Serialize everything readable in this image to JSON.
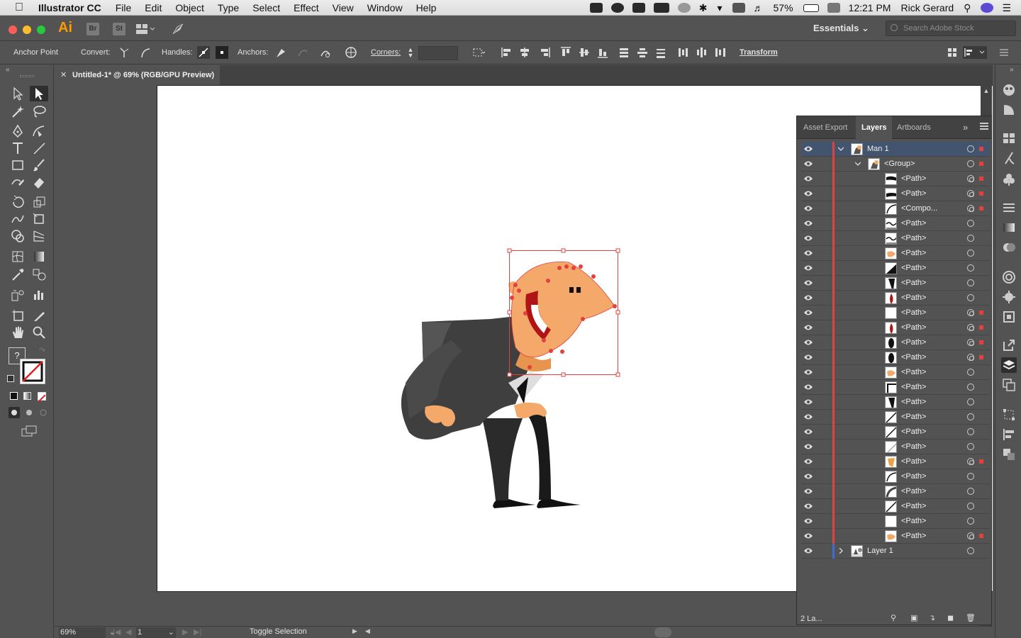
{
  "menubar": {
    "app_name": "Illustrator CC",
    "menus": [
      "File",
      "Edit",
      "Object",
      "Type",
      "Select",
      "Effect",
      "View",
      "Window",
      "Help"
    ],
    "battery": "57%",
    "time": "12:21 PM",
    "user": "Rick Gerard"
  },
  "appbar": {
    "logo": "Ai",
    "bridge": "Br",
    "stock": "St",
    "workspace": "Essentials",
    "search_placeholder": "Search Adobe Stock"
  },
  "control": {
    "tool_name": "Anchor Point",
    "convert": "Convert:",
    "handles": "Handles:",
    "anchors": "Anchors:",
    "corners": "Corners:",
    "transform": "Transform"
  },
  "document": {
    "tab_title": "Untitled-1* @ 69% (RGB/GPU Preview)"
  },
  "status": {
    "zoom": "69%",
    "page": "1",
    "label": "Toggle Selection"
  },
  "layers_panel": {
    "tabs": [
      "Asset Export",
      "Layers",
      "Artboards"
    ],
    "rows": [
      {
        "name": "Man 1",
        "level": 0,
        "target": "single",
        "sel": true,
        "thumb": "man",
        "expanded": true,
        "active": true
      },
      {
        "name": "<Group>",
        "level": 1,
        "target": "single",
        "sel": true,
        "thumb": "man",
        "expanded": true
      },
      {
        "name": "<Path>",
        "level": 2,
        "target": "double",
        "sel": true,
        "thumb": "black-top"
      },
      {
        "name": "<Path>",
        "level": 2,
        "target": "double",
        "sel": true,
        "thumb": "black-mid"
      },
      {
        "name": "<Compo...",
        "level": 2,
        "target": "double",
        "sel": true,
        "thumb": "curve"
      },
      {
        "name": "<Path>",
        "level": 2,
        "target": "single",
        "sel": false,
        "thumb": "wave"
      },
      {
        "name": "<Path>",
        "level": 2,
        "target": "single",
        "sel": false,
        "thumb": "wave"
      },
      {
        "name": "<Path>",
        "level": 2,
        "target": "single",
        "sel": false,
        "thumb": "orange"
      },
      {
        "name": "<Path>",
        "level": 2,
        "target": "single",
        "sel": false,
        "thumb": "black-tri"
      },
      {
        "name": "<Path>",
        "level": 2,
        "target": "single",
        "sel": false,
        "thumb": "black-bar"
      },
      {
        "name": "<Path>",
        "level": 2,
        "target": "single",
        "sel": false,
        "thumb": "red-leaf"
      },
      {
        "name": "<Path>",
        "level": 2,
        "target": "double",
        "sel": true,
        "thumb": "blank"
      },
      {
        "name": "<Path>",
        "level": 2,
        "target": "double",
        "sel": true,
        "thumb": "red-leaf"
      },
      {
        "name": "<Path>",
        "level": 2,
        "target": "double",
        "sel": true,
        "thumb": "black-oval"
      },
      {
        "name": "<Path>",
        "level": 2,
        "target": "double",
        "sel": true,
        "thumb": "black-oval"
      },
      {
        "name": "<Path>",
        "level": 2,
        "target": "single",
        "sel": false,
        "thumb": "orange"
      },
      {
        "name": "<Path>",
        "level": 2,
        "target": "single",
        "sel": false,
        "thumb": "black-corner"
      },
      {
        "name": "<Path>",
        "level": 2,
        "target": "single",
        "sel": false,
        "thumb": "black-bar"
      },
      {
        "name": "<Path>",
        "level": 2,
        "target": "single",
        "sel": false,
        "thumb": "line"
      },
      {
        "name": "<Path>",
        "level": 2,
        "target": "single",
        "sel": false,
        "thumb": "line"
      },
      {
        "name": "<Path>",
        "level": 2,
        "target": "single",
        "sel": false,
        "thumb": "line-light"
      },
      {
        "name": "<Path>",
        "level": 2,
        "target": "double",
        "sel": true,
        "thumb": "orange-shape"
      },
      {
        "name": "<Path>",
        "level": 2,
        "target": "single",
        "sel": false,
        "thumb": "curve"
      },
      {
        "name": "<Path>",
        "level": 2,
        "target": "single",
        "sel": false,
        "thumb": "grey-curve"
      },
      {
        "name": "<Path>",
        "level": 2,
        "target": "single",
        "sel": false,
        "thumb": "line"
      },
      {
        "name": "<Path>",
        "level": 2,
        "target": "single",
        "sel": false,
        "thumb": "blank"
      },
      {
        "name": "<Path>",
        "level": 2,
        "target": "double",
        "sel": true,
        "thumb": "orange"
      },
      {
        "name": "Layer 1",
        "level": 0,
        "target": "single",
        "sel": false,
        "thumb": "scene",
        "expanded": false,
        "blue": true
      }
    ],
    "footer_label": "2 La..."
  },
  "colors": {
    "ui_bg": "#535353",
    "selection_red": "#e34040",
    "suit": "#3f3f3f",
    "skin": "#f4a96a"
  }
}
